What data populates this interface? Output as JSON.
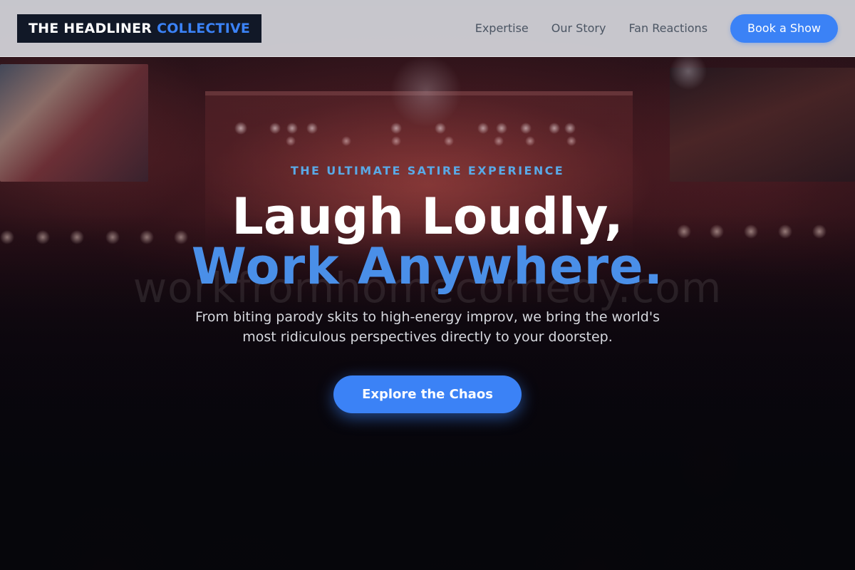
{
  "header": {
    "logo_primary": "THE HEADLINER",
    "logo_accent": "COLLECTIVE",
    "nav": [
      {
        "label": "Expertise"
      },
      {
        "label": "Our Story"
      },
      {
        "label": "Fan Reactions"
      }
    ],
    "cta_label": "Book a Show"
  },
  "hero": {
    "eyebrow": "THE ULTIMATE SATIRE EXPERIENCE",
    "headline_line1": "Laugh Loudly,",
    "headline_line2": "Work Anywhere.",
    "watermark": "workfromhomecomedy.com",
    "subtitle": "From biting parody skits to high-energy improv, we bring the world's most ridiculous perspectives directly to your doorstep.",
    "cta_label": "Explore the Chaos"
  },
  "colors": {
    "accent": "#3b82f6",
    "eyebrow": "#5aa9e6",
    "logo_bg": "#111827",
    "header_bg": "#e2e4ea"
  }
}
